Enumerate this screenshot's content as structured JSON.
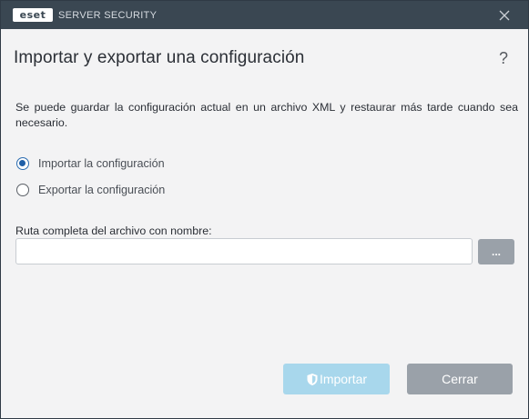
{
  "titlebar": {
    "logo_text": "eset",
    "app_title": "SERVER SECURITY",
    "close_icon": "close-icon"
  },
  "dialog": {
    "title": "Importar y exportar una configuración",
    "help_label": "?",
    "description": "Se puede guardar la configuración actual en un archivo XML y restaurar más tarde cuando sea necesario.",
    "options": [
      {
        "label": "Importar la configuración",
        "selected": true
      },
      {
        "label": "Exportar la configuración",
        "selected": false
      }
    ],
    "path_label": "Ruta completa del archivo con nombre:",
    "path_value": "",
    "path_placeholder": "",
    "browse_label": "...",
    "import_label": "Importar",
    "import_enabled": false,
    "close_label": "Cerrar"
  },
  "colors": {
    "titlebar_bg": "#3a4752",
    "body_bg": "#f3f3f4",
    "radio_selected": "#1f5fa8",
    "import_disabled_bg": "#a8d7ec",
    "secondary_button_bg": "#9aa1a9"
  }
}
